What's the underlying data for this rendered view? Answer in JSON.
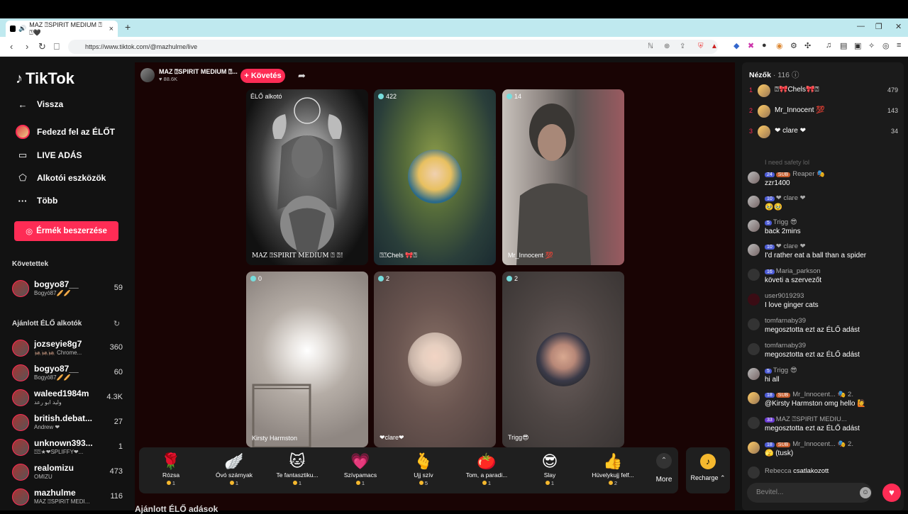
{
  "browser": {
    "tab_title": "MAZ ⍰SPIRIT MEDIUM ⍰ ⍰🖤",
    "url": "https://www.tiktok.com/@mazhulme/live"
  },
  "sidebar": {
    "logo": "TikTok",
    "menu": [
      {
        "label": "Vissza",
        "icon": "back-arrow-icon"
      },
      {
        "label": "Fedezd fel az ÉLŐT",
        "icon": "avatar"
      },
      {
        "label": "LIVE ADÁS",
        "icon": "video-icon"
      },
      {
        "label": "Alkotói eszközök",
        "icon": "creator-tools-icon"
      },
      {
        "label": "Több",
        "icon": "more-dots-icon"
      }
    ],
    "coins_button": "Érmék beszerzése",
    "following_header": "Követettek",
    "following": [
      {
        "name": "bogyo87__",
        "sub": "Bogyó87🥖🥖",
        "count": "59"
      }
    ],
    "recommended_header": "Ajánlott ÉLŐ alkotók",
    "recommended": [
      {
        "name": "jozseyie8g7",
        "sub": "🦗🦗🦗 Chrome...",
        "count": "360"
      },
      {
        "name": "bogyo87__",
        "sub": "Bogyó87🥖🥖",
        "count": "60"
      },
      {
        "name": "waleed1984m",
        "sub": "وليد ابو رعد",
        "count": "4.3K"
      },
      {
        "name": "british.debat...",
        "sub": "Andrew ❤",
        "count": "27"
      },
      {
        "name": "unknown393...",
        "sub": "⍰⍰★❤SPLIFFY❤...",
        "count": "1"
      },
      {
        "name": "realomizu",
        "sub": "OMIZU",
        "count": "473"
      },
      {
        "name": "mazhulme",
        "sub": "MAZ ⍰SPIRIT MEDI...",
        "count": "116"
      }
    ]
  },
  "stream": {
    "host_name": "MAZ ⍰SPIRIT MEDIUM ⍰...",
    "host_likes": "♥ 88.6K",
    "follow_label": "+ Követés",
    "tiles": [
      {
        "count": "ÉLŐ alkotó",
        "label": "MAZ ⍰SPIRIT MEDIUM ⍰ ⍰!"
      },
      {
        "count": "422",
        "label": "⍰⍰Chels 🎀⍰"
      },
      {
        "count": "14",
        "label": "Mr_Innocent 💯"
      },
      {
        "count": "0",
        "label": "Kirsty Harmston"
      },
      {
        "count": "2",
        "label": "❤clare❤"
      },
      {
        "count": "2",
        "label": "Trigg😎"
      }
    ],
    "gifts": [
      {
        "name": "Rózsa",
        "price": "1",
        "icon": "🌹"
      },
      {
        "name": "Óvó szárnyak",
        "price": "1",
        "icon": "🪽"
      },
      {
        "name": "Te fantasztiku...",
        "price": "1",
        "icon": "🐱"
      },
      {
        "name": "Szívpamacs",
        "price": "1",
        "icon": "💗"
      },
      {
        "name": "Ujj szív",
        "price": "5",
        "icon": "🫰"
      },
      {
        "name": "Tom, a paradi...",
        "price": "1",
        "icon": "🍅"
      },
      {
        "name": "Slay",
        "price": "1",
        "icon": "😎"
      },
      {
        "name": "Hüvelykujj felf...",
        "price": "2",
        "icon": "👍"
      }
    ],
    "more_label": "More",
    "recharge_label": "Recharge ⌃",
    "below_label": "Ajánlott ÉLŐ adások"
  },
  "viewers": {
    "title": "Nézők",
    "count": "· 116",
    "top": [
      {
        "rank": "1",
        "name": "⍰🎀Chels🎀⍰",
        "score": "479"
      },
      {
        "rank": "2",
        "name": "Mr_Innocent 💯",
        "score": "143"
      },
      {
        "rank": "3",
        "name": "❤ clare ❤",
        "score": "34"
      }
    ]
  },
  "chat": {
    "faded": "I need safety lol",
    "messages": [
      {
        "badge": "24",
        "sub": "SUB",
        "name": "Reaper 🎭",
        "msg": "zzr1400"
      },
      {
        "badge": "10",
        "sub": "",
        "name": "❤ clare ❤",
        "msg": "🥹🥹"
      },
      {
        "badge": "5",
        "sub": "",
        "name": "Trigg 😎",
        "msg": "back 2mins"
      },
      {
        "badge": "10",
        "sub": "",
        "name": "❤ clare ❤",
        "msg": "I'd rather eat a ball than a spider"
      },
      {
        "badge": "16",
        "sub": "",
        "name": "Maria_parkson",
        "msg": "követi a szervezőt"
      },
      {
        "badge": "",
        "sub": "",
        "name": "user9019293",
        "msg": "I love ginger cats"
      },
      {
        "badge": "",
        "sub": "",
        "name": "tomfarnaby39",
        "msg": "megosztotta ezt az ÉLŐ adást"
      },
      {
        "badge": "",
        "sub": "",
        "name": "tomfarnaby39",
        "msg": "megosztotta ezt az ÉLŐ adást"
      },
      {
        "badge": "5",
        "sub": "",
        "name": "Trigg 😎",
        "msg": "hi all"
      },
      {
        "badge": "18",
        "sub": "SUB",
        "name": "Mr_Innocent... 🎭 2.",
        "msg": "@Kirsty Harmston omg hello 🙋"
      },
      {
        "badge": "33",
        "sub": "",
        "name": "MAZ ⍰SPIRIT MEDIU...",
        "msg": "megosztotta ezt az ÉLŐ adást"
      },
      {
        "badge": "18",
        "sub": "SUB",
        "name": "Mr_Innocent... 🎭 2.",
        "msg": "🫣 (tusk)"
      }
    ],
    "join_name": "Rebecca",
    "join_msg": "csatlakozott",
    "input_placeholder": "Bevitel..."
  }
}
